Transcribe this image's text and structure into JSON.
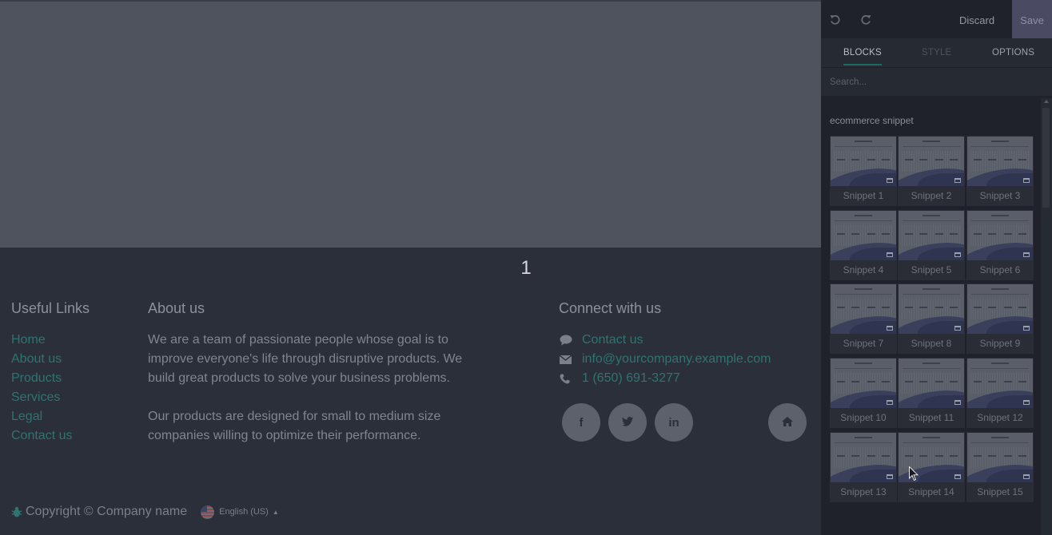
{
  "page": {
    "pager_number": "1",
    "footer": {
      "useful_links": {
        "title": "Useful Links",
        "items": [
          "Home",
          "About us",
          "Products",
          "Services",
          "Legal",
          "Contact us"
        ]
      },
      "about": {
        "title": "About us",
        "paragraph1": "We are a team of passionate people whose goal is to improve everyone's life through disruptive products. We build great products to solve your business problems.",
        "paragraph2": "Our products are designed for small to medium size companies willing to optimize their performance."
      },
      "connect": {
        "title": "Connect with us",
        "contact_label": "Contact us",
        "email": "info@yourcompany.example.com",
        "phone": "1 (650) 691-3277",
        "social_icons": [
          "facebook-icon",
          "twitter-icon",
          "linkedin-icon",
          "home-icon"
        ],
        "social_glyphs": {
          "facebook": "f",
          "twitter": "t",
          "linkedin": "in"
        }
      },
      "copyright": "Copyright © Company name",
      "language": "English (US)"
    }
  },
  "editor": {
    "toolbar": {
      "undo_icon": "undo-icon",
      "redo_icon": "redo-icon",
      "discard_label": "Discard",
      "save_label": "Save"
    },
    "tabs": [
      {
        "label": "BLOCKS",
        "state": "active"
      },
      {
        "label": "STYLE",
        "state": "disabled"
      },
      {
        "label": "OPTIONS",
        "state": "normal"
      }
    ],
    "search": {
      "placeholder": "Search..."
    },
    "section_title": "ecommerce snippet",
    "snippets": [
      "Snippet 1",
      "Snippet 2",
      "Snippet 3",
      "Snippet 4",
      "Snippet 5",
      "Snippet 6",
      "Snippet 7",
      "Snippet 8",
      "Snippet 9",
      "Snippet 10",
      "Snippet 11",
      "Snippet 12",
      "Snippet 13",
      "Snippet 14",
      "Snippet 15"
    ]
  },
  "colors": {
    "link": "#2e7471",
    "accent_tab": "#1a6b64",
    "save_bg": "#4a4a63",
    "overlay_page": "#4f535e",
    "footer_bg": "#2b2f39"
  }
}
